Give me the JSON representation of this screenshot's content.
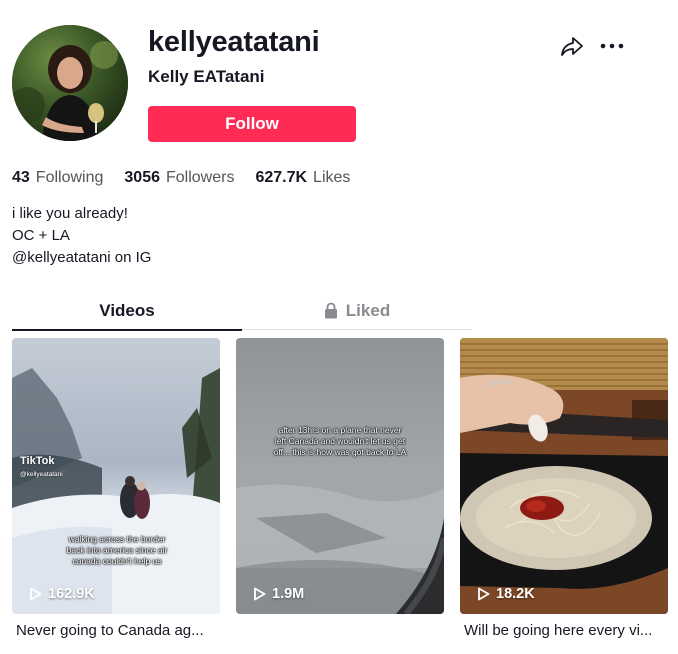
{
  "profile": {
    "username": "kellyeatatani",
    "nickname": "Kelly EATatani",
    "follow_label": "Follow",
    "avatar_icon": "avatar-photo",
    "bio_lines": [
      "i like you already!",
      "OC + LA",
      "@kellyeatatani on IG"
    ]
  },
  "header_actions": {
    "share_icon": "share-arrow-icon",
    "more_icon": "more-dots-icon"
  },
  "stats": [
    {
      "value": "43",
      "label": "Following"
    },
    {
      "value": "3056",
      "label": "Followers"
    },
    {
      "value": "627.7K",
      "label": "Likes"
    }
  ],
  "tabs": [
    {
      "label": "Videos",
      "active": true
    },
    {
      "label": "Liked",
      "active": false,
      "icon": "lock-icon"
    }
  ],
  "videos": [
    {
      "views": "162.9K",
      "caption": "Never going to Canada ag...",
      "overlay_text": "walking across the border back into america since air canada couldn't help us",
      "watermark": "TikTok",
      "watermark_handle": "@kellyeatatani"
    },
    {
      "views": "1.9M",
      "caption": "",
      "overlay_text": "after 13hrs on a plane that never left Canada and wouldn't let us get off... this is how was got back to LA"
    },
    {
      "views": "18.2K",
      "caption": "Will be going here every vi..."
    }
  ],
  "colors": {
    "accent": "#fe2c55",
    "text_primary": "#161823",
    "text_secondary": "#545559",
    "tab_inactive": "#8a8b91"
  }
}
